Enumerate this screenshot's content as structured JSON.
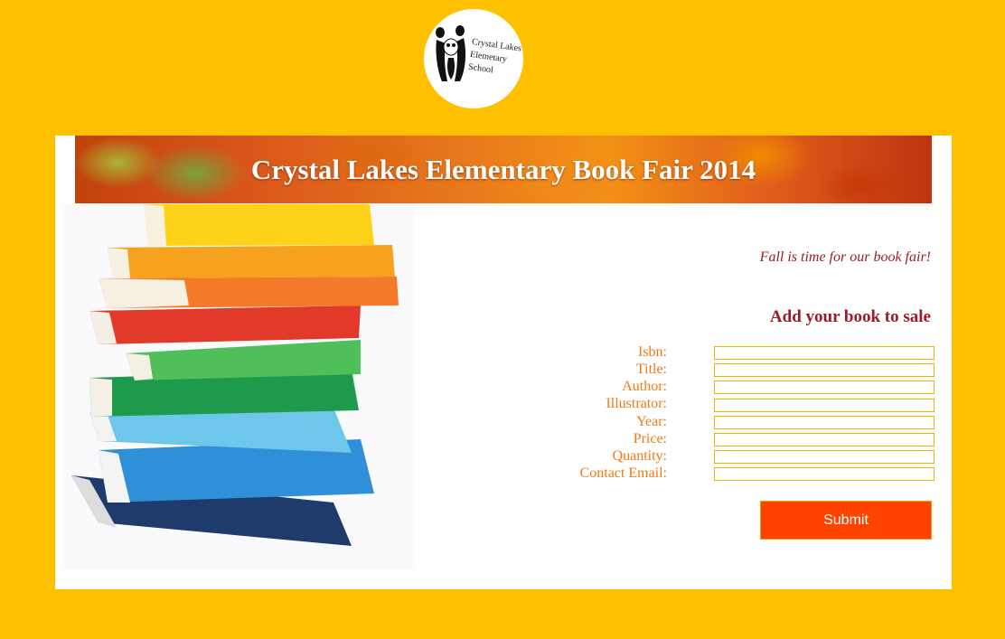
{
  "logo": {
    "line1": "Crystal Lakes",
    "line2": "Elemetary",
    "line3": "School"
  },
  "banner": {
    "title": "Crystal Lakes Elementary Book Fair 2014"
  },
  "tagline": "Fall is time for our book fair!",
  "form": {
    "title": "Add your book to sale",
    "fields": [
      {
        "label": "Isbn:",
        "value": ""
      },
      {
        "label": "Title:",
        "value": ""
      },
      {
        "label": "Author:",
        "value": ""
      },
      {
        "label": "Illustrator:",
        "value": ""
      },
      {
        "label": "Year:",
        "value": ""
      },
      {
        "label": "Price:",
        "value": ""
      },
      {
        "label": "Quantity:",
        "value": ""
      },
      {
        "label": "Contact Email:",
        "value": ""
      }
    ],
    "submit_label": "Submit"
  },
  "colors": {
    "page_background": "#ffc000",
    "accent_red": "#9b1c28",
    "label_orange": "#f07a14",
    "submit_background": "#ff4200"
  }
}
